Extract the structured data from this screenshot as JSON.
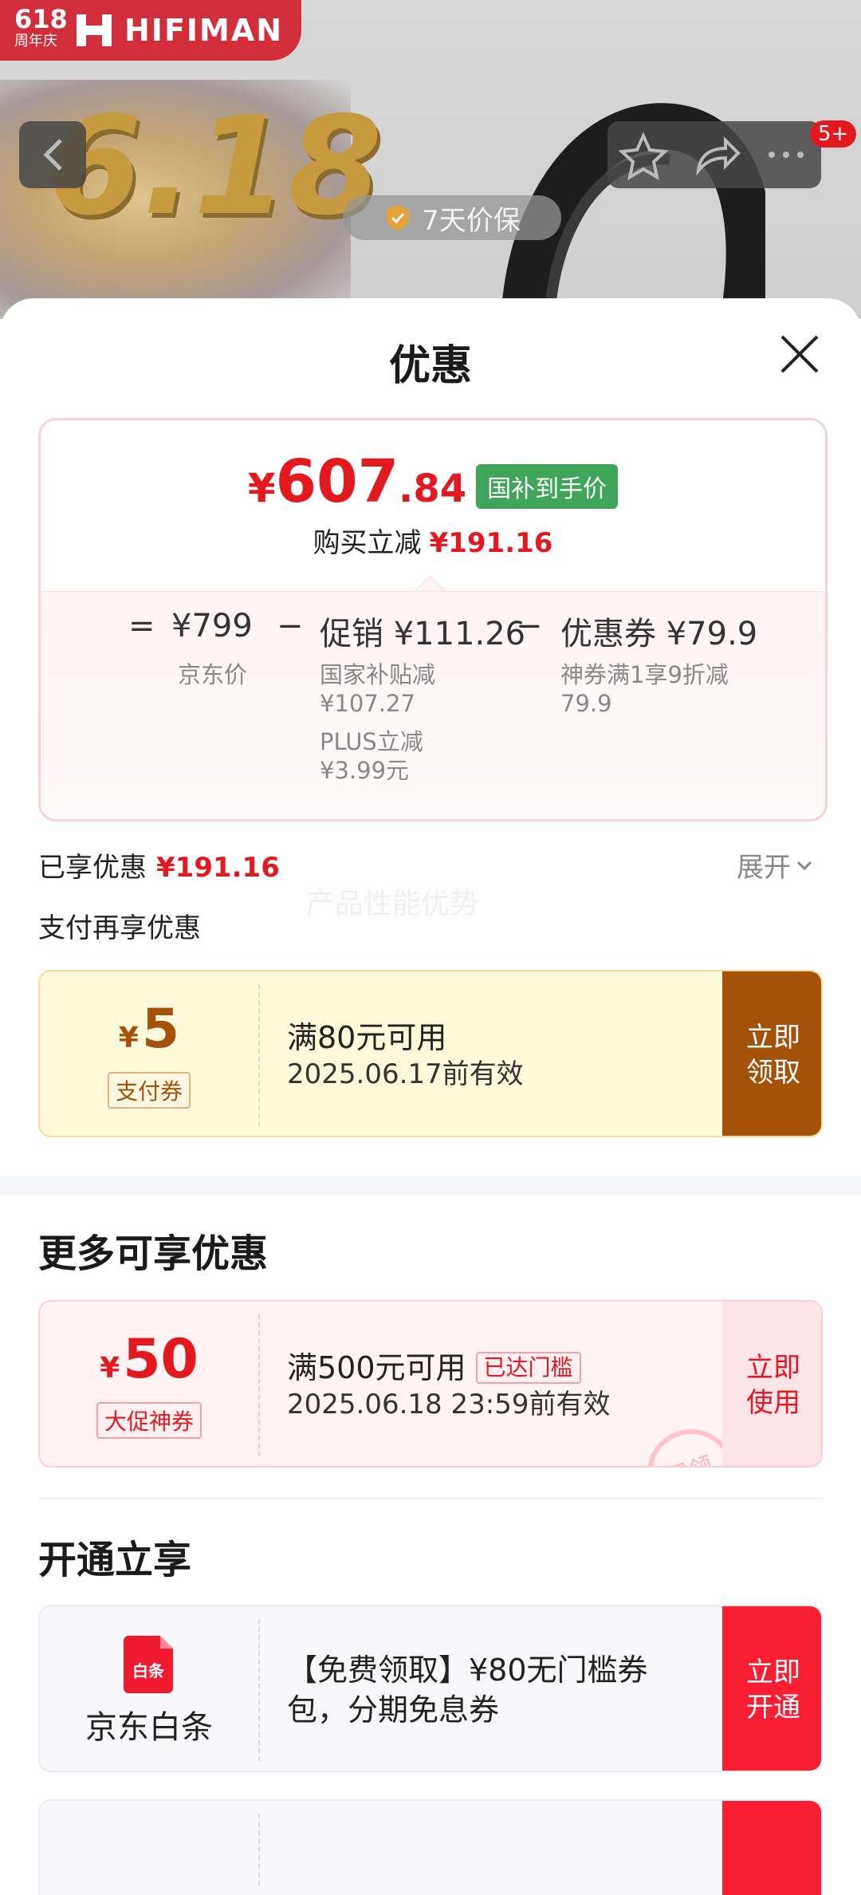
{
  "background": {
    "logo_618": "618",
    "logo_anniv": "周年庆",
    "brand": "HIFIMAN",
    "promo_text": "6.18",
    "price_guarantee": "7天价保",
    "cart_badge": "5+"
  },
  "sheet": {
    "title": "优惠"
  },
  "summary": {
    "price_symbol": "¥",
    "price_int": "607",
    "price_dec": ".84",
    "price_tag": "国补到手价",
    "cut_label": "购买立减",
    "cut_value": "¥191.16",
    "eq": "=",
    "minus": "−",
    "jd_price": "¥799",
    "jd_price_label": "京东价",
    "promo_label": "促销",
    "promo_value": "¥111.26",
    "promo_sub1": "国家补贴减",
    "promo_sub1_val": "¥107.27",
    "promo_sub2": "PLUS立减",
    "promo_sub2_val": "¥3.99元",
    "coupon_label": "优惠券",
    "coupon_value": "¥79.9",
    "coupon_sub1": "神券满1享9折减",
    "coupon_sub1_val": "79.9"
  },
  "enjoyed": {
    "label": "已享优惠",
    "value": "¥191.16",
    "expand": "展开",
    "watermark": "产品性能优势",
    "pay_title": "支付再享优惠"
  },
  "coupons": [
    {
      "symbol": "¥",
      "amount": "5",
      "tag": "支付券",
      "condition": "满80元可用",
      "validity": "2025.06.17前有效",
      "action_line1": "立即",
      "action_line2": "领取"
    },
    {
      "symbol": "¥",
      "amount": "50",
      "tag": "大促神券",
      "condition": "满500元可用",
      "reached": "已达门槛",
      "validity": "2025.06.18 23:59前有效",
      "action_line1": "立即",
      "action_line2": "使用",
      "stamp": "已领"
    }
  ],
  "sections": {
    "more": "更多可享优惠",
    "open": "开通立享"
  },
  "baitiao": {
    "icon_text": "白条",
    "name": "京东白条",
    "desc": "【免费领取】¥80无门槛券包，分期免息券",
    "action_line1": "立即",
    "action_line2": "开通"
  },
  "colors": {
    "accent_red": "#e4191f",
    "pay_brown": "#a4520a",
    "open_red": "#fa1e32",
    "tag_green": "#3ea55b"
  },
  "icons": [
    "back-icon",
    "star-icon",
    "share-icon",
    "more-icon",
    "shield-check-icon",
    "close-icon",
    "chevron-down-icon",
    "baitiao-icon"
  ]
}
